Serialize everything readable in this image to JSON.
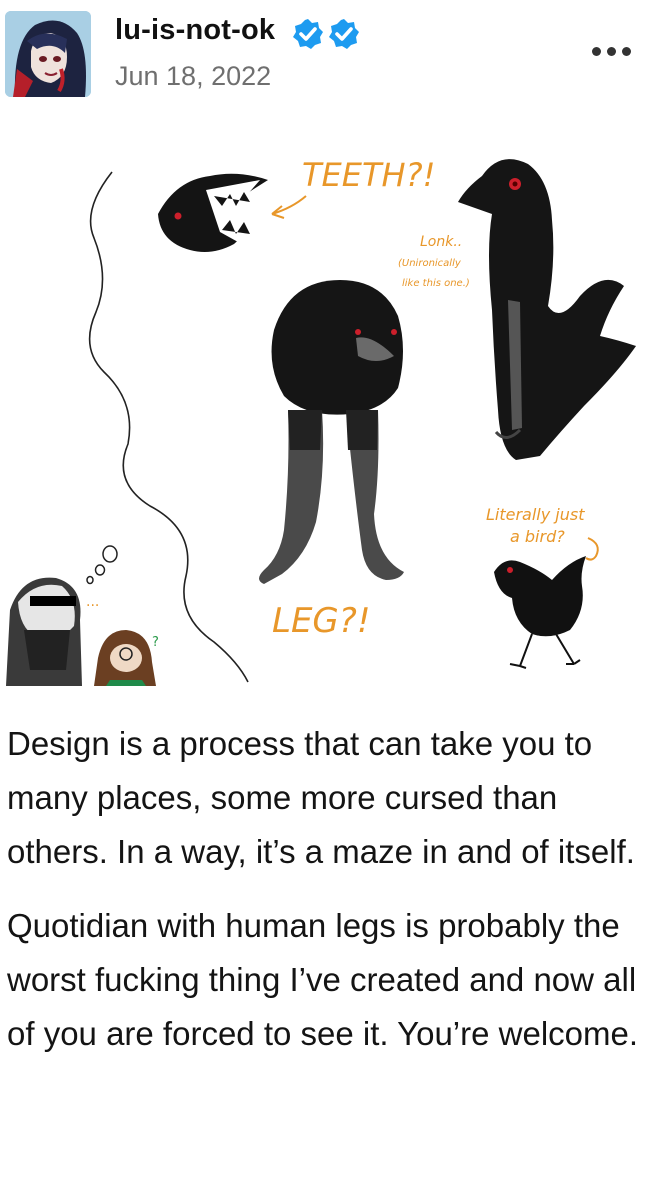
{
  "header": {
    "username": "lu-is-not-ok",
    "date": "Jun 18, 2022",
    "badge_color": "#1d9bf0"
  },
  "artwork": {
    "labels": {
      "teeth": "TEETH?!",
      "lonk": "Lonk..",
      "lonk_note_1": "(Unironically",
      "lonk_note_2": "like this one.)",
      "leg": "LEG?!",
      "bird_1": "Literally just",
      "bird_2": "a bird?",
      "question": "?",
      "ellipsis": "..."
    },
    "ink_color": "#e8972a"
  },
  "body": {
    "paragraph_1": "Design is a process that can take you to many places, some more cursed than others. In a way, it’s a maze in and of itself.",
    "paragraph_2": "Quotidian with human legs is probably the worst fucking thing I’ve created and now all of you are forced to see it. You’re welcome."
  }
}
